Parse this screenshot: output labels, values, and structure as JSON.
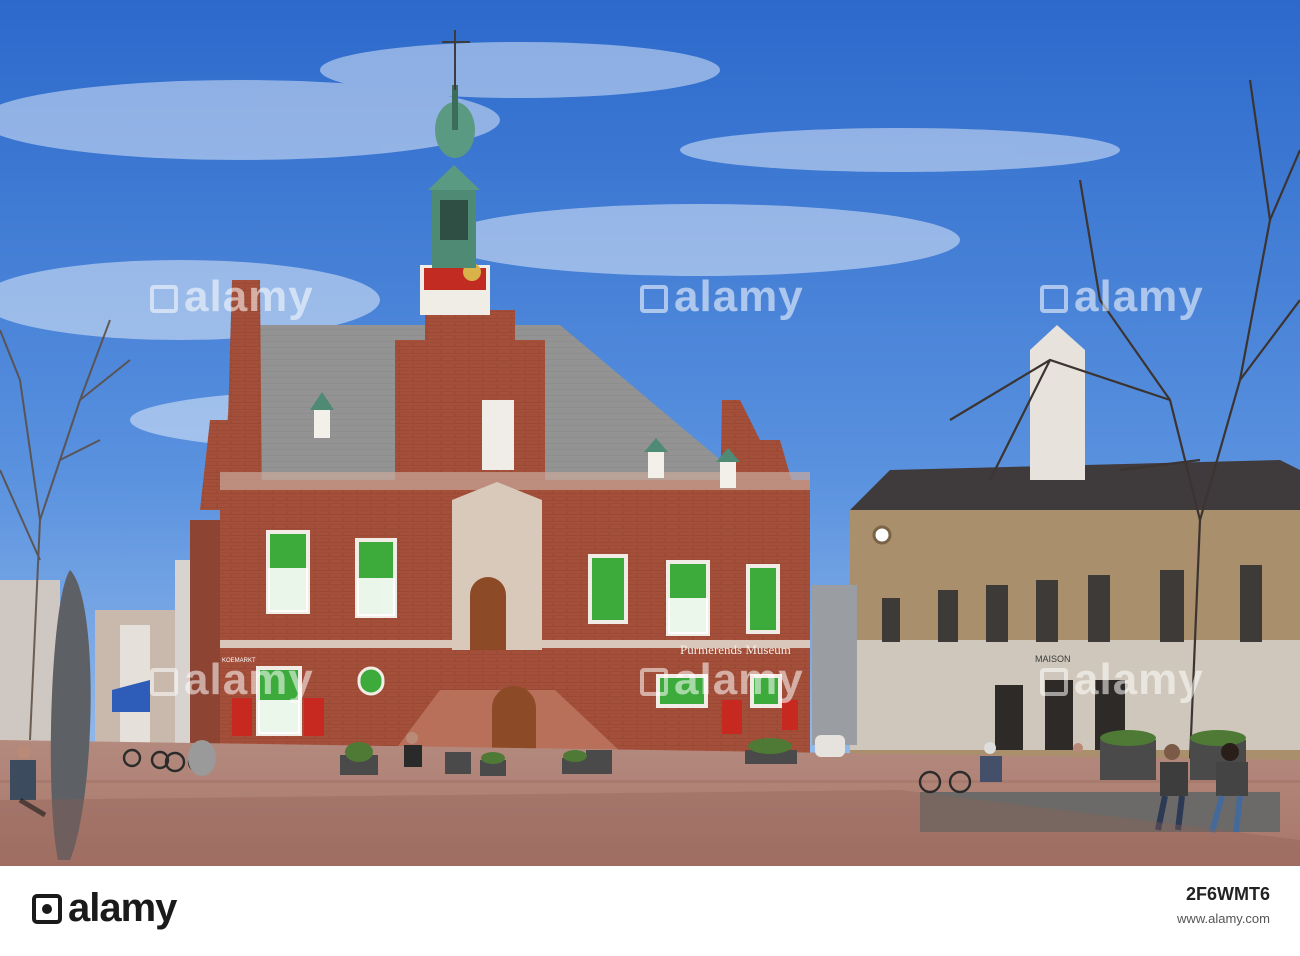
{
  "image": {
    "watermark_text": "alamy",
    "museum_sign": "Purmerends Museum",
    "shop_sign": "MAISON",
    "street_sign": "KOEMARKT"
  },
  "footer": {
    "brand": "alamy",
    "image_id": "2F6WMT6",
    "url": "www.alamy.com"
  },
  "colors": {
    "sky_top": "#2f6fd0",
    "sky_bottom": "#8fb8ea",
    "brick": "#a24e38",
    "roof": "#8f8f8f",
    "tower_green": "#4f8a74",
    "window_green": "#3aa63a",
    "pavement": "#b58373"
  }
}
